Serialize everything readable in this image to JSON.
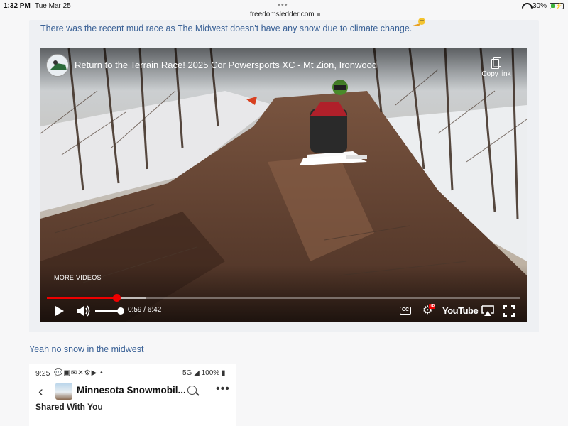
{
  "status_bar": {
    "time": "1:32 PM",
    "date": "Tue Mar 25",
    "url": "freedomsledder.com",
    "battery_percent": "30%",
    "battery_level": 0.3
  },
  "post": {
    "text": "There was the recent mud race as The Midwest doesn't have any snow due to climate change."
  },
  "video": {
    "title": "Return to the Terrain Race! 2025 Cor Powersports XC - Mt Zion, Ironwood",
    "copy_link_label": "Copy link",
    "more_videos_label": "MORE VIDEOS",
    "time_display": "0:59 / 6:42",
    "progress_fraction": 0.147,
    "buffered_fraction": 0.21,
    "volume_fraction": 1.0,
    "cc_label": "CC",
    "hd_badge": "HD",
    "brand": "YouTube",
    "accent_color": "#ee0000"
  },
  "reply": {
    "text": "Yeah no snow in the midwest"
  },
  "embedded_screenshot": {
    "time": "9:25",
    "network": "5G",
    "battery": "100%",
    "group_title": "Minnesota Snowmobil...",
    "section_label": "Shared With You"
  }
}
